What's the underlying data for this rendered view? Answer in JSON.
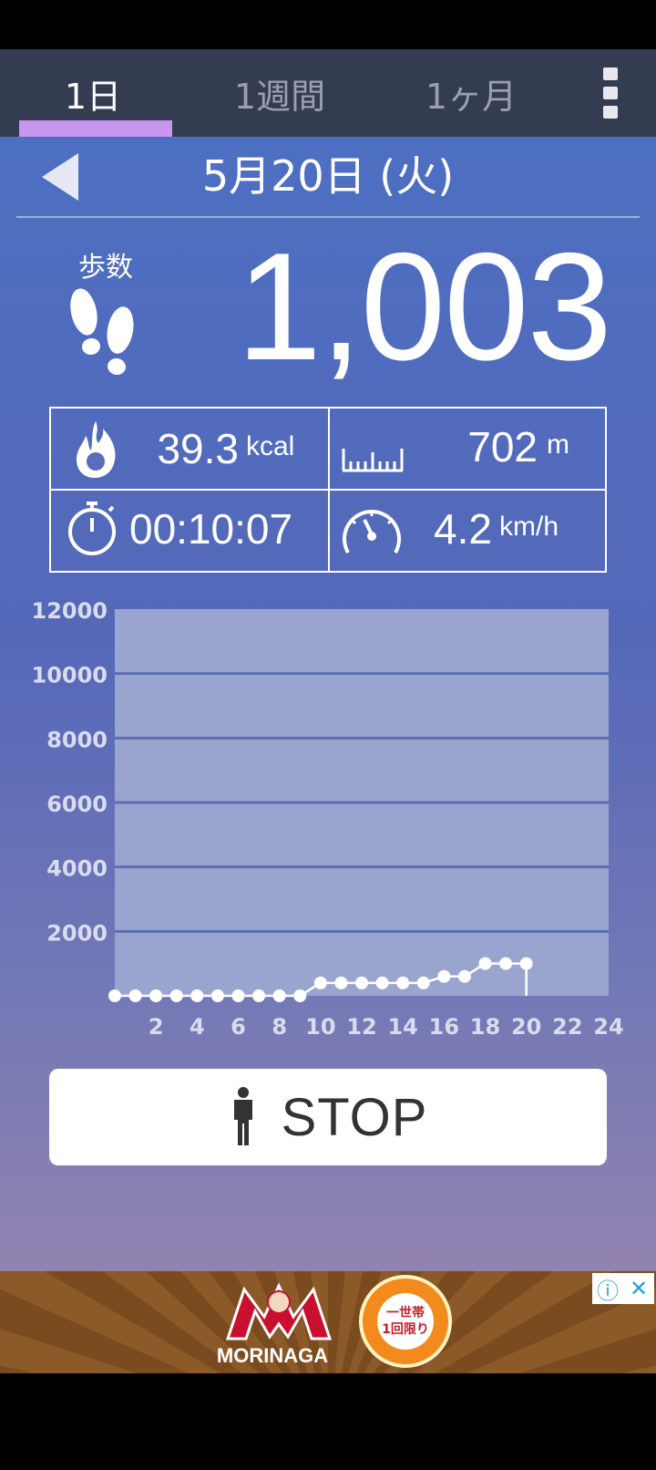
{
  "tabs": [
    {
      "label": "1日",
      "active": true
    },
    {
      "label": "1週間",
      "active": false
    },
    {
      "label": "1ヶ月",
      "active": false
    }
  ],
  "date": {
    "label": "5月20日 (火)"
  },
  "steps": {
    "label": "歩数",
    "value": "1,003"
  },
  "stats": {
    "calories": {
      "value": "39.3",
      "unit": "kcal"
    },
    "distance": {
      "value": "702",
      "unit": "m"
    },
    "time": {
      "value": "00:10:07"
    },
    "speed": {
      "value": "4.2",
      "unit": "km/h"
    }
  },
  "chart_data": {
    "type": "line",
    "title": "",
    "xlabel": "",
    "ylabel": "",
    "xlim": [
      0,
      24
    ],
    "ylim": [
      0,
      12000
    ],
    "x_ticks": [
      "2",
      "4",
      "6",
      "8",
      "10",
      "12",
      "14",
      "16",
      "18",
      "20",
      "22",
      "24"
    ],
    "y_ticks": [
      "2000",
      "4000",
      "6000",
      "8000",
      "10000",
      "12000"
    ],
    "grid": true,
    "series": [
      {
        "x": [
          0,
          1,
          2,
          3,
          4,
          5,
          6,
          7,
          8,
          9,
          10,
          11,
          12,
          13,
          14,
          15,
          16,
          17,
          18,
          19,
          20
        ],
        "y": [
          0,
          0,
          0,
          0,
          0,
          0,
          0,
          0,
          0,
          0,
          400,
          400,
          400,
          400,
          400,
          400,
          600,
          600,
          1000,
          1000,
          1000
        ]
      }
    ],
    "colors": {
      "plot_bg": "#9aa5cf",
      "gridline": "#5a6db5",
      "line": "#ffffff",
      "tick_label": "#d8dcee"
    }
  },
  "stop_button": {
    "label": "STOP"
  },
  "ad": {
    "brand": "MORINAGA",
    "badge_line1": "一世帯",
    "badge_line2": "1回限り",
    "info_icon": "ⓘ",
    "close_icon": "✕"
  },
  "colors": {
    "tabbar": "#333c50",
    "tab_indicator": "#c896f0",
    "main_top": "#4d6fc2",
    "main_bottom": "#9183b0"
  }
}
